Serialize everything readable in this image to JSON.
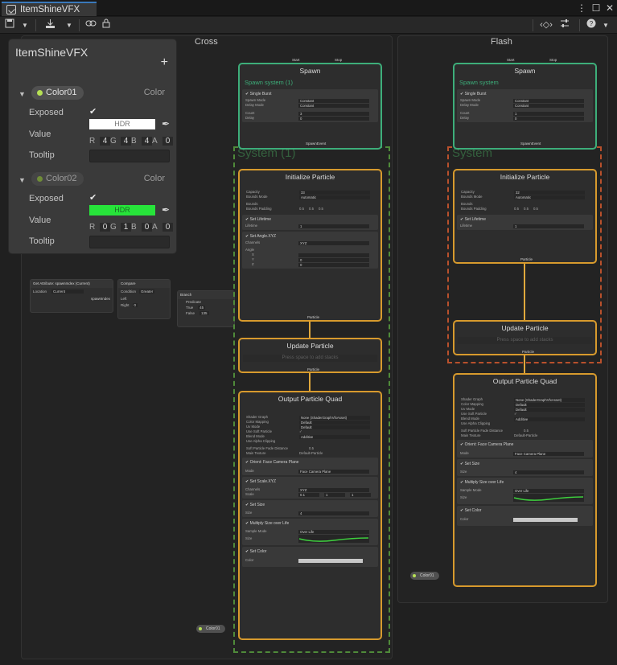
{
  "tab": {
    "title": "ItemShineVFX"
  },
  "contexts": [
    {
      "title": "Cross"
    },
    {
      "title": "Flash"
    }
  ],
  "blackboard": {
    "title": "ItemShineVFX",
    "add_label": "+",
    "properties": [
      {
        "name": "Color01",
        "type": "Color",
        "exposed_label": "Exposed",
        "value_label": "Value",
        "tooltip_label": "Tooltip",
        "swatch_text": "HDR",
        "swatch_color": "#ffffff",
        "rgba": [
          "R",
          "4",
          "G",
          "4",
          "B",
          "4",
          "A",
          "0"
        ]
      },
      {
        "name": "Color02",
        "type": "Color",
        "exposed_label": "Exposed",
        "value_label": "Value",
        "tooltip_label": "Tooltip",
        "swatch_text": "HDR",
        "swatch_color": "#27e33a",
        "rgba": [
          "R",
          "0",
          "G",
          "1",
          "B",
          "0",
          "A",
          "0"
        ]
      }
    ]
  },
  "left_nodes": {
    "get_attr": {
      "title": "Get Attribute: spawnIndex (Current)",
      "location_label": "Location",
      "location_value": "Current",
      "out_label": "spawnIndex"
    },
    "compare": {
      "title": "Compare",
      "condition_label": "Condition",
      "condition_value": "Greater",
      "left_label": "Left",
      "right_label": "Right",
      "right_value": "0"
    },
    "branch": {
      "title": "Branch",
      "predicate_label": "Predicate",
      "true_label": "True",
      "true_value": "45",
      "false_label": "False",
      "false_value": "135"
    }
  },
  "cross": {
    "spawn": {
      "title": "Spawn",
      "start": "Start",
      "stop": "Stop",
      "system": "Spawn system (1)",
      "block": "Single Burst",
      "rows": [
        [
          "Spawn Mode",
          "Constant"
        ],
        [
          "Delay Mode",
          "Constant"
        ],
        [
          "Count",
          "3"
        ],
        [
          "Delay",
          "0"
        ]
      ],
      "flow_out": "SpawnEvent"
    },
    "system_name": "System (1)",
    "init": {
      "title": "Initialize Particle",
      "badge": "(Local)",
      "capacity": [
        "Capacity",
        "33"
      ],
      "bounds_mode": [
        "Bounds Mode",
        "Automatic"
      ],
      "bounds": "Bounds",
      "bounds_padding": "Bounds Padding",
      "padding": [
        "0.5",
        "0.5",
        "0.5"
      ],
      "lifetime_block": "Set Lifetime",
      "lifetime": [
        "Lifetime",
        "1"
      ],
      "angle_block": "Set Angle.XYZ",
      "channels": [
        "Channels",
        "XYZ"
      ],
      "angle": "Angle",
      "axes": [
        [
          "X",
          ""
        ],
        [
          "Y",
          "0"
        ],
        [
          "Z",
          "0"
        ]
      ],
      "flow_out": "Particle"
    },
    "update": {
      "title": "Update Particle",
      "badge": "(Local)",
      "press": "Press space to add stacks",
      "flow_out": "Particle"
    },
    "output": {
      "title": "Output Particle Quad",
      "badge": "(Local)",
      "rows": [
        [
          "Shader Graph",
          "None (ShaderGraphVfxAsset)"
        ],
        [
          "Color Mapping",
          "Default"
        ],
        [
          "Uv Mode",
          "Default"
        ],
        [
          "Use Soft Particle",
          "✓"
        ],
        [
          "Blend Mode",
          "Additive"
        ],
        [
          "Use Alpha Clipping",
          ""
        ]
      ],
      "fade": [
        "Soft Particle Fade Distance",
        "0.5"
      ],
      "tex": [
        "Main Texture",
        "Default-Particle"
      ],
      "orient_block": "Orient: Face Camera Plane",
      "orient_mode": [
        "Mode",
        "Face Camera Plane"
      ],
      "scale_block": "Set Scale.XYZ",
      "scale_channels": [
        "Channels",
        "XYZ"
      ],
      "scale": [
        "Scale",
        "0.1",
        "1",
        "1"
      ],
      "size_block": "Set Size",
      "size": [
        "Size",
        "4"
      ],
      "mult_block": "Multiply Size over Life",
      "sample": [
        "Sample Mode",
        "Over Life"
      ],
      "size_curve": "Size",
      "color_block": "Set Color",
      "color_row": "Color",
      "color_in": "Color01"
    }
  },
  "flash": {
    "spawn": {
      "title": "Spawn",
      "start": "Start",
      "stop": "Stop",
      "system": "Spawn system",
      "block": "Single Burst",
      "rows": [
        [
          "Spawn Mode",
          "Constant"
        ],
        [
          "Delay Mode",
          "Constant"
        ],
        [
          "Count",
          "1"
        ],
        [
          "Delay",
          "0"
        ]
      ],
      "flow_out": "SpawnEvent"
    },
    "system_name": "System",
    "init": {
      "title": "Initialize Particle",
      "badge": "(Local)",
      "capacity": [
        "Capacity",
        "32"
      ],
      "bounds_mode": [
        "Bounds Mode",
        "Automatic"
      ],
      "bounds": "Bounds",
      "bounds_padding": "Bounds Padding",
      "padding": [
        "0.5",
        "0.5",
        "0.5"
      ],
      "lifetime_block": "Set Lifetime",
      "lifetime": [
        "Lifetime",
        "1"
      ],
      "flow_out": "Particle"
    },
    "update": {
      "title": "Update Particle",
      "badge": "(Local)",
      "press": "Press space to add stacks",
      "flow_out": "Particle"
    },
    "output": {
      "title": "Output Particle Quad",
      "badge": "(Local)",
      "rows": [
        [
          "Shader Graph",
          "None (ShaderGraphVfxAsset)"
        ],
        [
          "Color Mapping",
          "Default"
        ],
        [
          "Uv Mode",
          "Default"
        ],
        [
          "Use Soft Particle",
          "✓"
        ],
        [
          "Blend Mode",
          "Additive"
        ],
        [
          "Use Alpha Clipping",
          ""
        ]
      ],
      "fade": [
        "Soft Particle Fade Distance",
        "0.5"
      ],
      "tex": [
        "Main Texture",
        "Default-Particle"
      ],
      "orient_block": "Orient: Face Camera Plane",
      "orient_mode": [
        "Mode",
        "Face Camera Plane"
      ],
      "size_block": "Set Size",
      "size": [
        "Size",
        "4"
      ],
      "mult_block": "Multiply Size over Life",
      "sample": [
        "Sample Mode",
        "Over Life"
      ],
      "size_curve": "Size",
      "color_block": "Set Color",
      "color_row": "Color",
      "color_in": "Color01"
    }
  },
  "colors": {
    "accent_tab": "#3a79bb",
    "context_green": "#3dae7a",
    "context_orange": "#d79a2d",
    "system_dash_green": "#4f8a3a",
    "system_dash_red": "#b8502c",
    "curve": "#3ed13e"
  }
}
